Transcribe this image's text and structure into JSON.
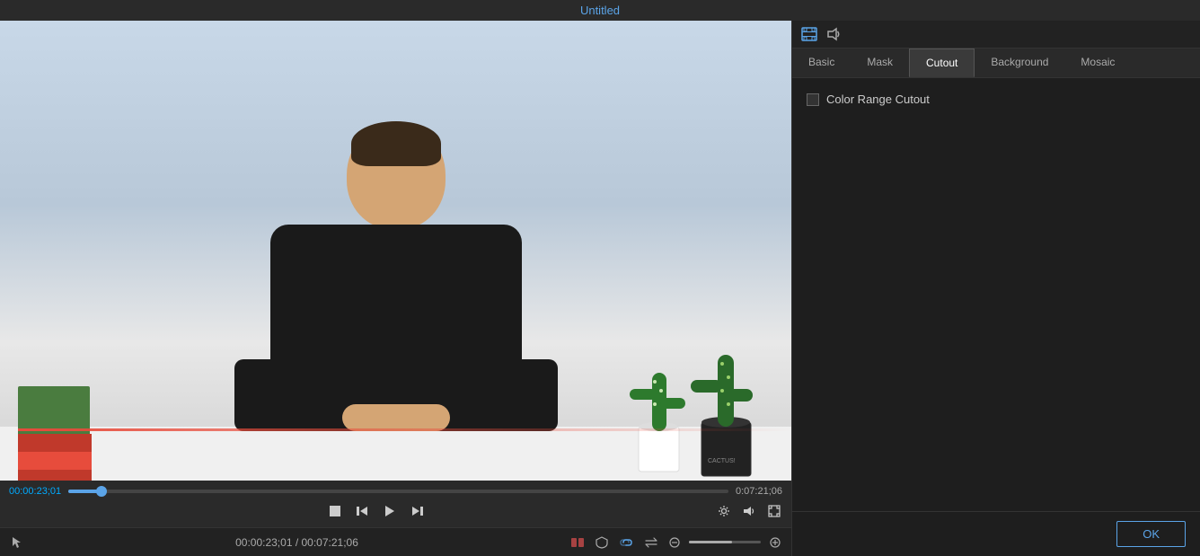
{
  "title": "Untitled",
  "tabs": {
    "basic": "Basic",
    "mask": "Mask",
    "cutout": "Cutout",
    "background": "Background",
    "mosaic": "Mosaic",
    "active": "cutout"
  },
  "cutout": {
    "color_range_label": "Color Range Cutout"
  },
  "controls": {
    "time_current": "00:00:23;01",
    "time_total": "0:07:21;06",
    "status_time": "00:00:23;01 / 00:07:21;06"
  },
  "buttons": {
    "ok": "OK"
  }
}
